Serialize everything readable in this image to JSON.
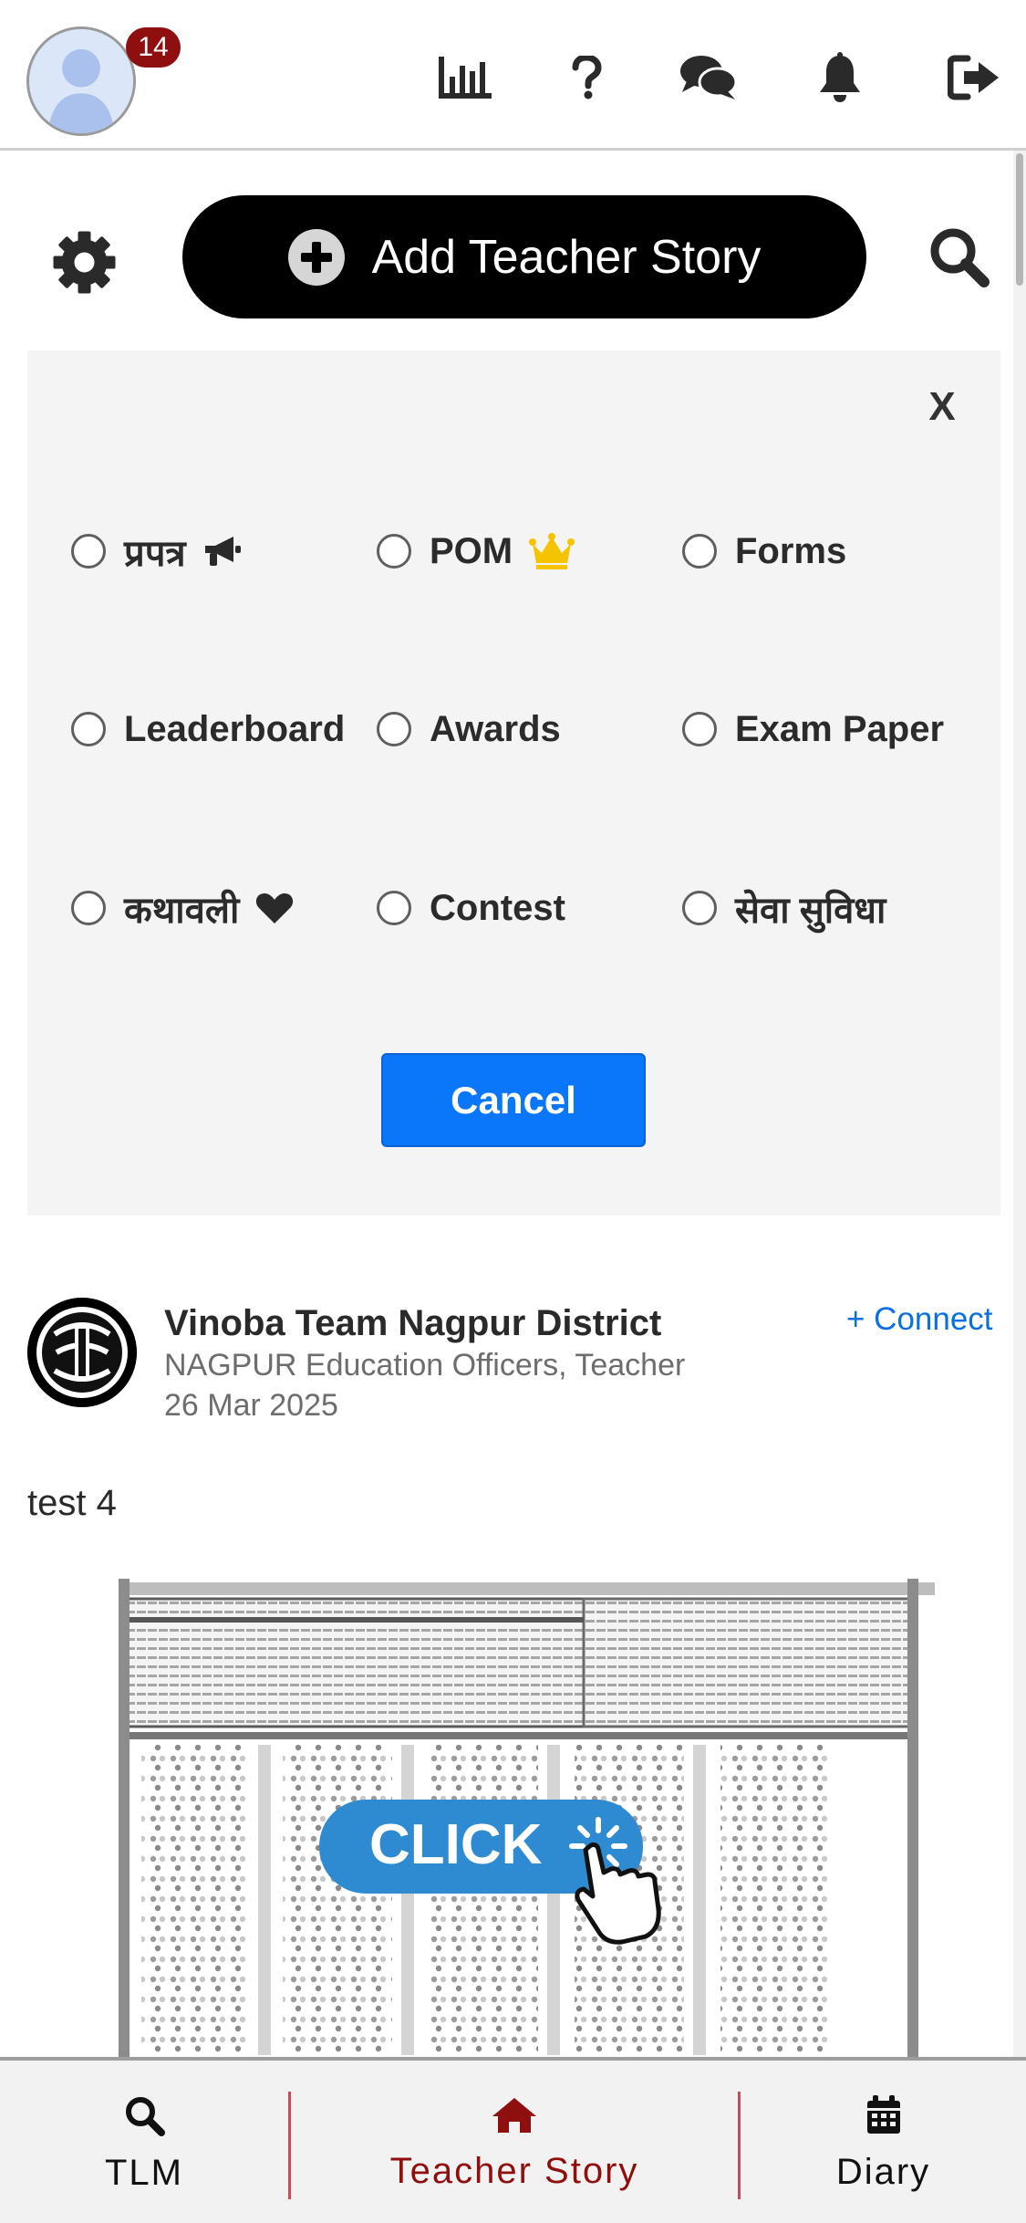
{
  "header": {
    "notification_count": "14",
    "icons": [
      "chart-icon",
      "help-icon",
      "chat-icon",
      "bell-icon",
      "logout-icon"
    ]
  },
  "actions": {
    "add_story_label": "Add Teacher Story"
  },
  "filter": {
    "close_label": "X",
    "options": [
      {
        "label": "प्रपत्र",
        "icon": "megaphone-icon"
      },
      {
        "label": "POM",
        "icon": "crown-icon"
      },
      {
        "label": "Forms",
        "icon": ""
      },
      {
        "label": "Leaderboard",
        "icon": ""
      },
      {
        "label": "Awards",
        "icon": ""
      },
      {
        "label": "Exam Paper",
        "icon": ""
      },
      {
        "label": "कथावली",
        "icon": "heart-icon"
      },
      {
        "label": "Contest",
        "icon": ""
      },
      {
        "label": "सेवा सुविधा",
        "icon": ""
      }
    ],
    "cancel_label": "Cancel"
  },
  "post": {
    "author": "Vinoba Team Nagpur District",
    "role": "NAGPUR Education Officers, Teacher",
    "date": "26 Mar 2025",
    "connect_label": "+ Connect",
    "text": "test 4",
    "image_overlay_label": "CLICK"
  },
  "bottom_nav": {
    "items": [
      {
        "label": "TLM",
        "icon": "search-icon"
      },
      {
        "label": "Teacher Story",
        "icon": "home-icon"
      },
      {
        "label": "Diary",
        "icon": "calendar-icon"
      }
    ],
    "active_color": "#8f0e0e"
  },
  "colors": {
    "accent_blue": "#0a76fa",
    "badge": "#8f0e0e",
    "crown": "#f6c300"
  }
}
